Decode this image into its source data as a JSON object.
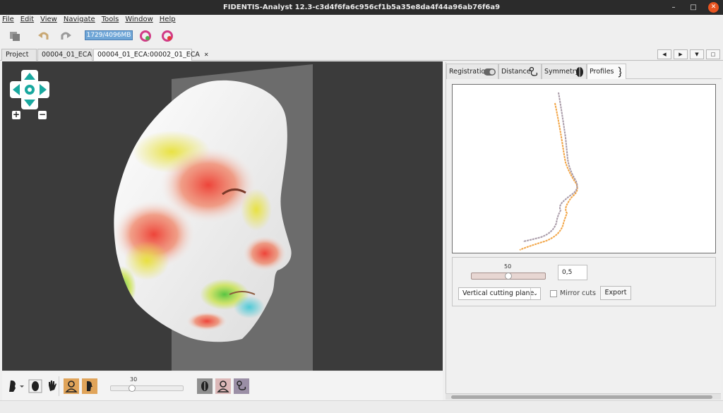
{
  "window": {
    "title": "FIDENTIS-Analyst 12.3-c3d4f6fa6c956cf1b5a35e8da4f44a96ab76f6a9",
    "minimize_glyph": "–",
    "maximize_glyph": "□",
    "close_glyph": "✕"
  },
  "menu": {
    "items": [
      "File",
      "Edit",
      "View",
      "Navigate",
      "Tools",
      "Window",
      "Help"
    ]
  },
  "toolbar": {
    "memory": "1729/4096MB",
    "icons": [
      "save-all-icon",
      "undo-icon",
      "redo-icon",
      "add-face-icon",
      "remove-face-icon"
    ]
  },
  "tabs": [
    {
      "label": "Project",
      "closable": false
    },
    {
      "label": "00004_01_ECA",
      "closable": true
    },
    {
      "label": "00004_01_ECA:00002_01_ECA",
      "closable": true
    }
  ],
  "tab_close_glyph": "✕",
  "tab_nav": {
    "prev": "◀",
    "next": "▶",
    "menu": "▼",
    "restore": "□"
  },
  "viewport": {
    "zoom_in": "+",
    "zoom_out": "−"
  },
  "bottom_bar": {
    "slider_value": "30",
    "slider_fraction": 0.3,
    "icons": [
      "profile-mode-icon",
      "face-outline-icon",
      "hand-icon",
      "primary-face-icon",
      "secondary-face-icon",
      "symmetry-face-icon",
      "user-face-icon",
      "distance-face-icon"
    ]
  },
  "right_panel": {
    "tabs": [
      {
        "label": "Registration",
        "active": false
      },
      {
        "label": "Distance",
        "active": false
      },
      {
        "label": "Symmetry",
        "active": false
      },
      {
        "label": "Profiles",
        "active": true
      }
    ],
    "profiles": {
      "slider_value": "50",
      "slider_fraction": 0.5,
      "scale_input": "0,5",
      "cutting_plane": "Vertical cutting plane",
      "mirror_cuts_label": "Mirror cuts",
      "mirror_cuts_checked": false,
      "export_label": "Export",
      "colors": {
        "primary_profile": "#a89aa7",
        "secondary_profile": "#f2a444"
      }
    }
  }
}
